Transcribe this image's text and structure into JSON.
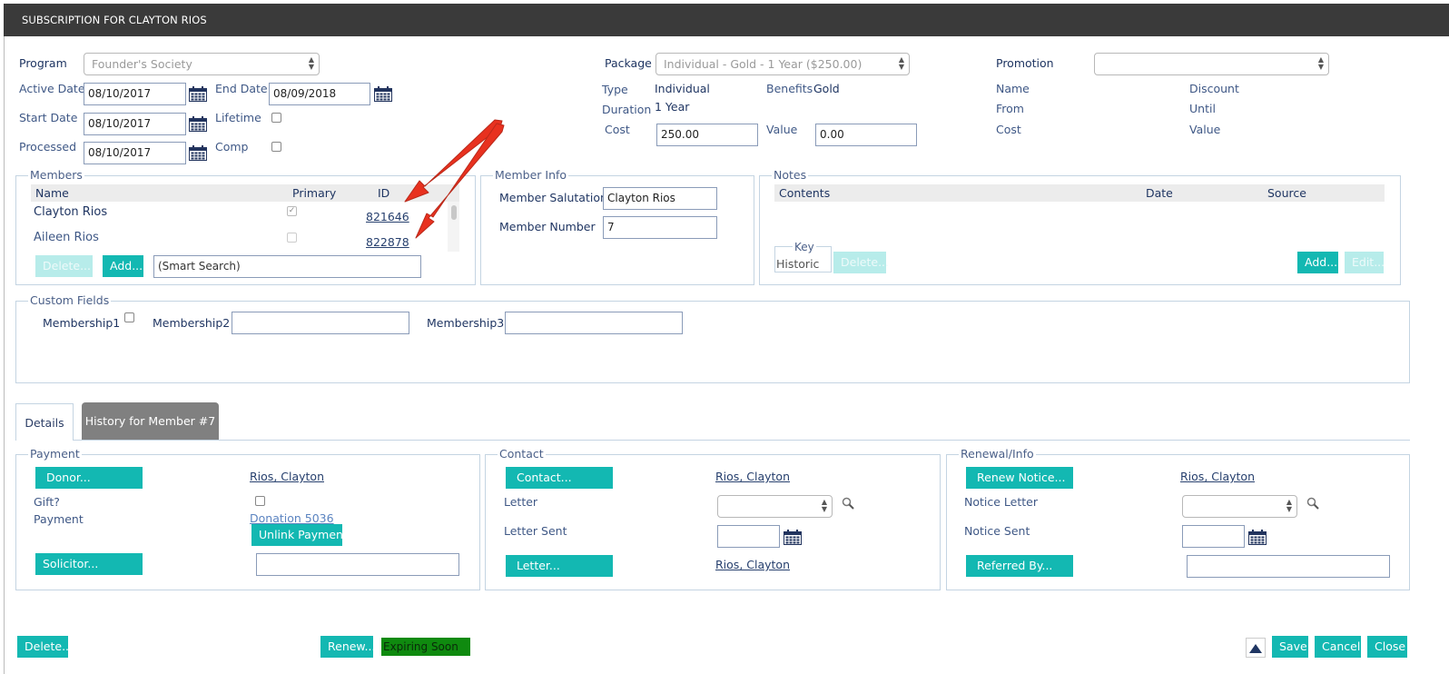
{
  "title": "SUBSCRIPTION FOR CLAYTON RIOS",
  "top": {
    "program_label": "Program",
    "program_value": "Founder's Society",
    "active_date_label": "Active Date",
    "active_date": "08/10/2017",
    "end_date_label": "End Date",
    "end_date": "08/09/2018",
    "start_date_label": "Start Date",
    "start_date": "08/10/2017",
    "lifetime_label": "Lifetime",
    "processed_label": "Processed",
    "processed_date": "08/10/2017",
    "comp_label": "Comp"
  },
  "package": {
    "label": "Package",
    "value": "Individual - Gold - 1 Year ($250.00)",
    "type_label": "Type",
    "type_value": "Individual",
    "benefits_label": "Benefits",
    "benefits_value": "Gold",
    "duration_label": "Duration",
    "duration_value": "1 Year",
    "cost_label": "Cost",
    "cost_value": "250.00",
    "value_label": "Value",
    "value_value": "0.00"
  },
  "promotion": {
    "label": "Promotion",
    "value": "",
    "name_label": "Name",
    "discount_label": "Discount",
    "from_label": "From",
    "until_label": "Until",
    "cost_label": "Cost",
    "value_label": "Value"
  },
  "members": {
    "legend": "Members",
    "col_name": "Name",
    "col_primary": "Primary",
    "col_id": "ID",
    "rows": [
      {
        "name": "Clayton Rios",
        "primary": true,
        "id": "821646"
      },
      {
        "name": "Aileen Rios",
        "primary": false,
        "id": "822878"
      }
    ],
    "delete_label": "Delete...",
    "add_label": "Add...",
    "search_placeholder": "(Smart Search)"
  },
  "member_info": {
    "legend": "Member Info",
    "salutation_label": "Member Salutation",
    "salutation_value": "Clayton Rios",
    "number_label": "Member Number",
    "number_value": "7"
  },
  "notes": {
    "legend": "Notes",
    "col_contents": "Contents",
    "col_date": "Date",
    "col_source": "Source",
    "key_legend": "Key",
    "key_value": "Historic",
    "delete_label": "Delete...",
    "add_label": "Add...",
    "edit_label": "Edit..."
  },
  "custom_fields": {
    "legend": "Custom Fields",
    "m1_label": "Membership1",
    "m2_label": "Membership2",
    "m3_label": "Membership3",
    "m2_value": "",
    "m3_value": ""
  },
  "tabs": {
    "details": "Details",
    "history": "History for Member #7"
  },
  "payment": {
    "legend": "Payment",
    "donor_button": "Donor...",
    "donor_link": "Rios, Clayton",
    "gift_label": "Gift?",
    "payment_label": "Payment",
    "payment_link": "Donation 5036",
    "unlink_button": "Unlink Payment",
    "solicitor_button": "Solicitor...",
    "solicitor_value": ""
  },
  "contact": {
    "legend": "Contact",
    "contact_button": "Contact...",
    "contact_link": "Rios, Clayton",
    "letter_label": "Letter",
    "letter_sent_label": "Letter Sent",
    "letter_button": "Letter...",
    "letter_link": "Rios, Clayton"
  },
  "renewal": {
    "legend": "Renewal/Info",
    "renew_notice_button": "Renew Notice...",
    "renew_link": "Rios, Clayton",
    "notice_letter_label": "Notice Letter",
    "notice_sent_label": "Notice Sent",
    "referred_button": "Referred By...",
    "referred_value": ""
  },
  "footer": {
    "delete_label": "Delete...",
    "renew_label": "Renew...",
    "status_text": "Expiring Soon",
    "save_label": "Save",
    "cancel_label": "Cancel",
    "close_label": "Close"
  },
  "colors": {
    "accent": "#13b8b2",
    "title_bar": "#3a3a3a",
    "status_badge": "#0f8a0f",
    "annotation_arrow": "#e8311f"
  }
}
